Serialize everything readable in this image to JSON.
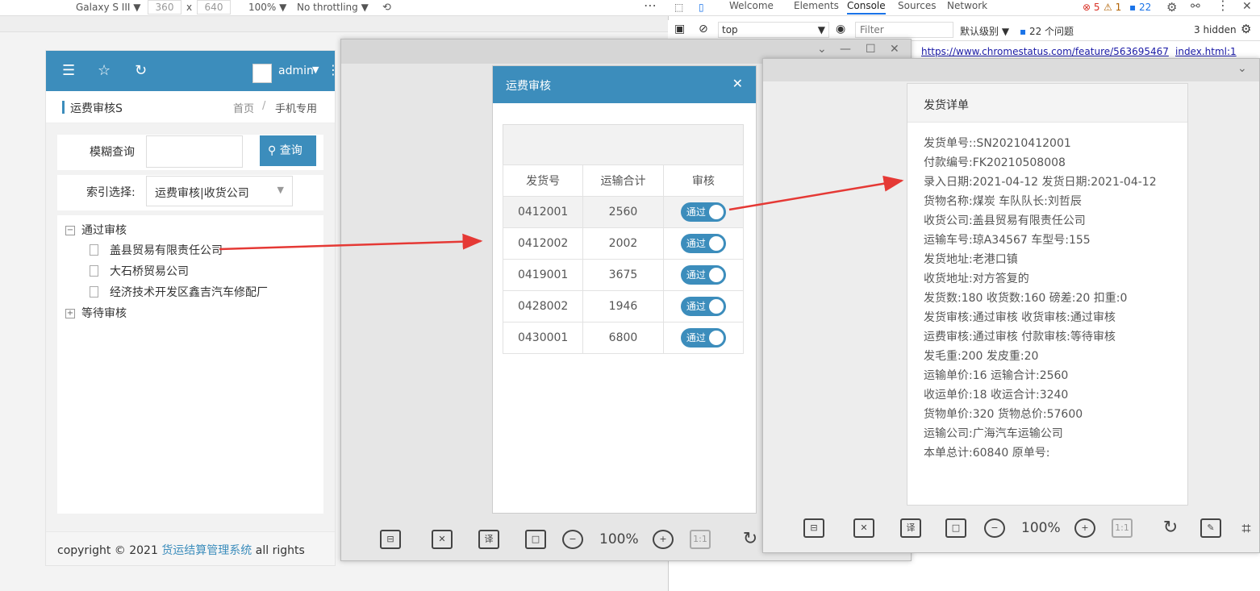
{
  "devtools": {
    "device": "Galaxy S III ▼",
    "width": "360",
    "x": "x",
    "height": "640",
    "zoom": "100% ▼",
    "throttling": "No throttling ▼",
    "tabs": [
      "Welcome",
      "Elements",
      "Console",
      "Sources",
      "Network"
    ],
    "errors": "5",
    "warnings": "1",
    "messages": "22",
    "context": "top",
    "filter_placeholder": "Filter",
    "level": "默认级别 ▼",
    "issues": "22 个问题",
    "hidden": "3 hidden",
    "link1": "https://www.chromestatus.com/feature/563695467",
    "link2": "index.html:1"
  },
  "app": {
    "user": "admin",
    "page_title": "运费审核S",
    "breadcrumb_home": "首页",
    "breadcrumb_sep": "/",
    "breadcrumb_current": "手机专用",
    "search_label": "模糊查询",
    "search_value": "",
    "search_button": "查询",
    "index_label": "索引选择:",
    "index_value": "运费审核|收货公司",
    "tree": {
      "passed": "通过审核",
      "passed_items": [
        "盖县贸易有限责任公司",
        "大石桥贸易公司",
        "经济技术开发区鑫吉汽车修配厂"
      ],
      "pending": "等待审核"
    },
    "footer_prefix": "copyright © 2021 ",
    "footer_link": "货运结算管理系统",
    "footer_suffix": " all rights"
  },
  "dialog1": {
    "title": "运费审核",
    "columns": [
      "发货号",
      "运输合计",
      "审核"
    ],
    "rows": [
      {
        "no": "0412001",
        "total": "2560",
        "status": "通过"
      },
      {
        "no": "0412002",
        "total": "2002",
        "status": "通过"
      },
      {
        "no": "0419001",
        "total": "3675",
        "status": "通过"
      },
      {
        "no": "0428002",
        "total": "1946",
        "status": "通过"
      },
      {
        "no": "0430001",
        "total": "6800",
        "status": "通过"
      }
    ],
    "zoom": "100%"
  },
  "dialog2": {
    "title": "发货详单",
    "lines": [
      "发货单号::SN20210412001",
      "付款编号:FK20210508008",
      "录入日期:2021-04-12    发货日期:2021-04-12",
      "货物名称:煤炭    车队队长:刘哲辰",
      "收货公司:盖县贸易有限责任公司",
      "运输车号:琼A34567    车型号:155",
      "发货地址:老港口镇",
      "收货地址:对方答复的",
      "发货数:180    收货数:160    磅差:20    扣重:0",
      "发货审核:通过审核    收货审核:通过审核",
      "运费审核:通过审核    付款审核:等待审核",
      "发毛重:200    发皮重:20",
      "运输单价:16    运输合计:2560",
      "收运单价:18    收运合计:3240",
      "货物单价:320    货物总价:57600",
      "运输公司:广海汽车运输公司",
      "本单总计:60840    原单号:"
    ],
    "zoom": "100%"
  },
  "colors": {
    "primary": "#3c8dbc",
    "arrow": "#e53935"
  }
}
